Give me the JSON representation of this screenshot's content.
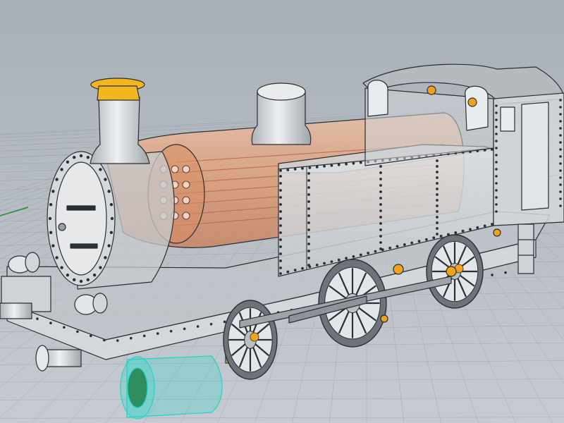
{
  "viewport": {
    "label": "",
    "background_top": "#a9afb7",
    "background_bottom": "#c6cbd1",
    "grid_color": "#8c939b",
    "axis_green": "#1f8f2f",
    "axis_red": "#b33a2a"
  },
  "model": {
    "name": "",
    "colors": {
      "body": "#c9cdd1",
      "body_light": "#dfe2e5",
      "edge": "#2b2e33",
      "boiler_copper": "#e49a6f",
      "chimney_cap": "#f2b61f",
      "selected": "#19d6c9",
      "highlight_orange": "#f2a21a"
    }
  }
}
